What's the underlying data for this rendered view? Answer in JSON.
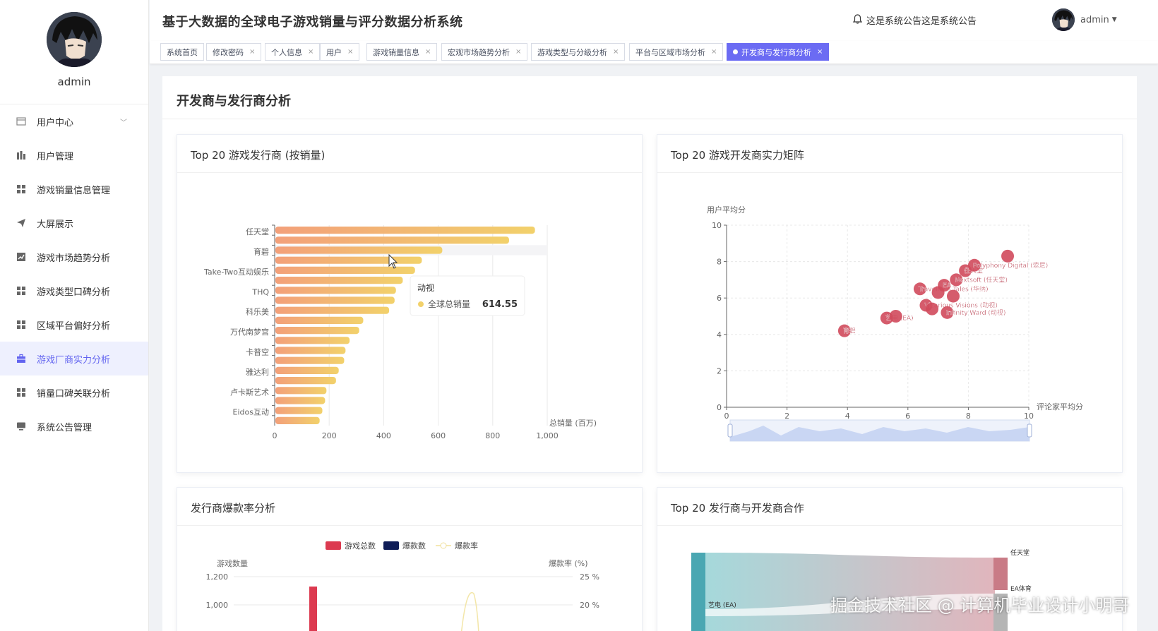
{
  "sidebar": {
    "username": "admin",
    "items": [
      {
        "label": "用户中心",
        "icon": "window-icon",
        "group": true
      },
      {
        "label": "用户管理",
        "icon": "chart-bars-icon"
      },
      {
        "label": "游戏销量信息管理",
        "icon": "grid-icon"
      },
      {
        "label": "大屏展示",
        "icon": "send-icon"
      },
      {
        "label": "游戏市场趋势分析",
        "icon": "trend-icon"
      },
      {
        "label": "游戏类型口碑分析",
        "icon": "grid-icon"
      },
      {
        "label": "区域平台偏好分析",
        "icon": "grid-icon"
      },
      {
        "label": "游戏厂商实力分析",
        "icon": "briefcase-icon",
        "active": true
      },
      {
        "label": "销量口碑关联分析",
        "icon": "grid-icon"
      },
      {
        "label": "系统公告管理",
        "icon": "monitor-icon"
      }
    ]
  },
  "header": {
    "title": "基于大数据的全球电子游戏销量与评分数据分析系统",
    "notice": "这是系统公告这是系统公告",
    "user": "admin"
  },
  "tabs": [
    {
      "label": "系统首页",
      "closable": false
    },
    {
      "label": "修改密码",
      "closable": true
    },
    {
      "label": "个人信息",
      "closable": true
    },
    {
      "label": "用户",
      "closable": true
    },
    {
      "label": "游戏销量信息",
      "closable": true
    },
    {
      "label": "宏观市场趋势分析",
      "closable": true
    },
    {
      "label": "游戏类型与分级分析",
      "closable": true
    },
    {
      "label": "平台与区域市场分析",
      "closable": true
    },
    {
      "label": "开发商与发行商分析",
      "closable": true,
      "active": true
    }
  ],
  "page": {
    "title": "开发商与发行商分析"
  },
  "cards": {
    "publishers": "Top 20 游戏发行商 (按销量)",
    "developers": "Top 20 游戏开发商实力矩阵",
    "hitrate": "发行商爆款率分析",
    "coop": "Top 20 发行商与开发商合作"
  },
  "colors": {
    "accent": "#6b6bf3",
    "bar_start": "#f3a07a",
    "bar_end": "#f2d16b",
    "scatter": "#d04a5c",
    "hit_total": "#dc3a50",
    "hit_count": "#0f1d57"
  },
  "chart_data": [
    {
      "type": "bar",
      "orientation": "horizontal",
      "title": "Top 20 游戏发行商 (按销量)",
      "xlabel": "总销量 (百万)",
      "xlim": [
        0,
        1000
      ],
      "xticks": [
        "0",
        "200",
        "400",
        "600",
        "800",
        "1,000"
      ],
      "categories": [
        "任天堂",
        "",
        "育碧",
        "",
        "Take-Two互动娱乐",
        "",
        "THQ",
        "",
        "科乐美",
        "",
        "万代南梦宫",
        "",
        "卡普空",
        "",
        "雅达利",
        "",
        "卢卡斯艺术",
        "",
        "Eidos互动",
        ""
      ],
      "values": [
        955,
        860,
        615,
        540,
        515,
        470,
        445,
        440,
        420,
        325,
        310,
        275,
        260,
        255,
        235,
        225,
        190,
        185,
        175,
        165
      ],
      "tooltip": {
        "title": "动视",
        "series": "全球总销量",
        "value": "614.55"
      }
    },
    {
      "type": "scatter",
      "title": "Top 20 游戏开发商实力矩阵",
      "xlabel": "评论家平均分",
      "ylabel": "用户平均分",
      "xlim": [
        0,
        10
      ],
      "ylim": [
        0,
        10
      ],
      "xticks": [
        "0",
        "2",
        "4",
        "6",
        "8",
        "10"
      ],
      "yticks": [
        "0",
        "2",
        "4",
        "6",
        "8",
        "10"
      ],
      "points": [
        {
          "x": 3.9,
          "y": 4.2,
          "label": "育碧"
        },
        {
          "x": 5.3,
          "y": 4.9,
          "label": "艺电 (EA)"
        },
        {
          "x": 5.6,
          "y": 5.0,
          "label": ""
        },
        {
          "x": 6.6,
          "y": 5.6,
          "label": "Vicarious Visions (动视)"
        },
        {
          "x": 6.8,
          "y": 5.4,
          "label": ""
        },
        {
          "x": 7.3,
          "y": 5.2,
          "label": "Infinity Ward (动视)"
        },
        {
          "x": 6.4,
          "y": 6.5,
          "label": "Traveller's Tales (华纳)"
        },
        {
          "x": 7.2,
          "y": 6.7,
          "label": "EA"
        },
        {
          "x": 7.6,
          "y": 7.0,
          "label": "Nextsoft (任天堂)"
        },
        {
          "x": 7.9,
          "y": 7.5,
          "label": "任天堂"
        },
        {
          "x": 8.2,
          "y": 7.8,
          "label": "Polyphony Digital (索尼)"
        },
        {
          "x": 9.3,
          "y": 8.3,
          "label": ""
        },
        {
          "x": 7.5,
          "y": 6.1,
          "label": ""
        },
        {
          "x": 7.0,
          "y": 6.3,
          "label": ""
        }
      ]
    },
    {
      "type": "bar",
      "title": "发行商爆款率分析",
      "legend": [
        "游戏总数",
        "爆款数",
        "爆款率"
      ],
      "ylabel": "游戏数量",
      "y2label": "爆款率 (%)",
      "yticks": [
        "1,200",
        "1,000"
      ],
      "y2ticks": [
        "25 %",
        "20 %"
      ]
    },
    {
      "type": "sankey",
      "title": "Top 20 发行商与开发商合作",
      "nodes_left": [
        "艺电 (EA)"
      ],
      "nodes_right": [
        "任天堂",
        "EA体育"
      ]
    }
  ],
  "watermark": "掘金技术社区 @ 计算机毕业设计小明哥"
}
